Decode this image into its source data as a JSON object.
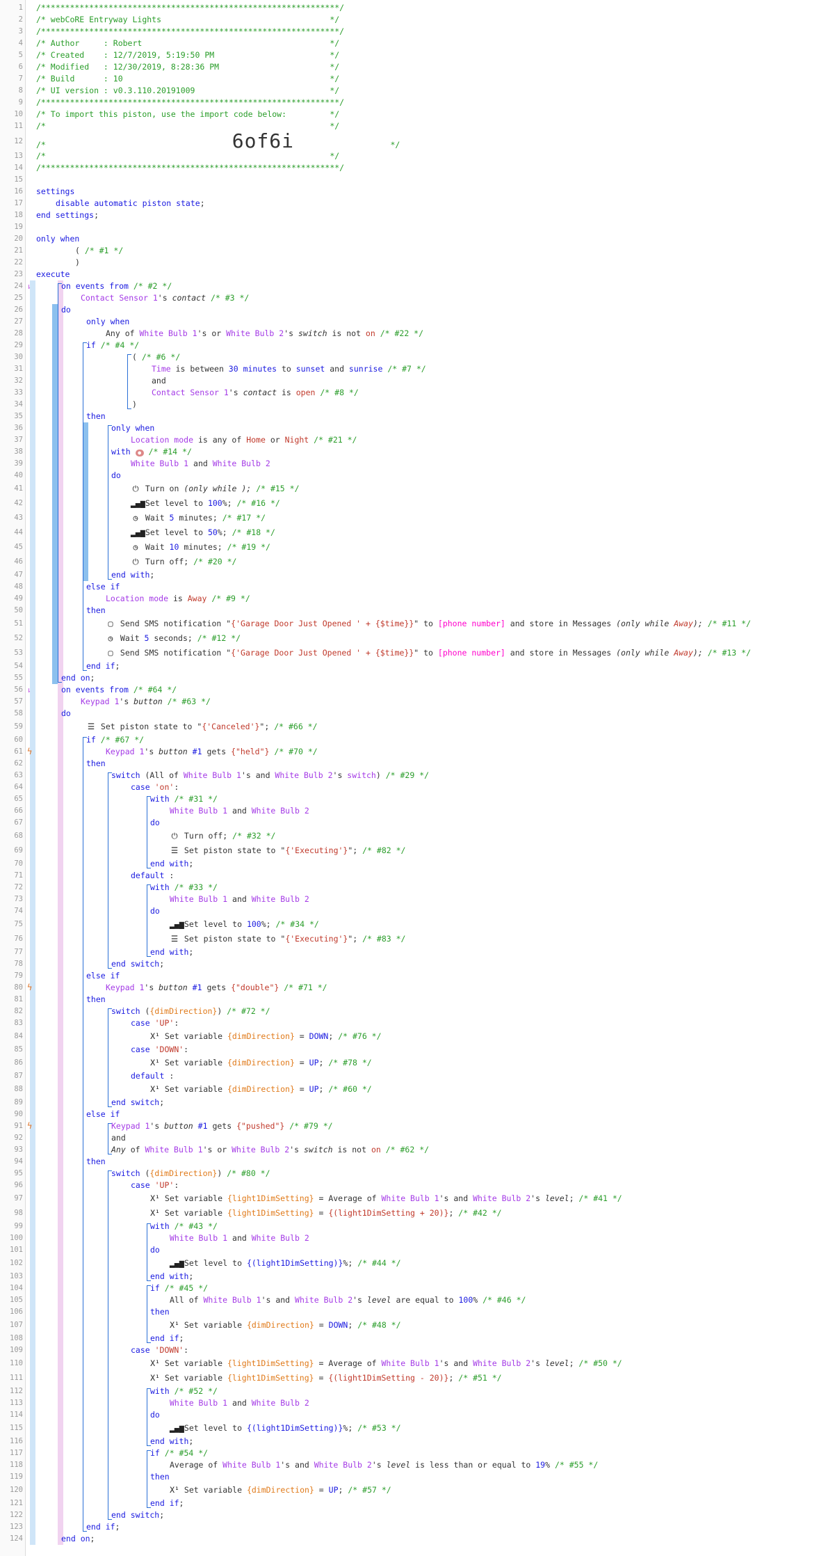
{
  "piston": {
    "name": "webCoRE Entryway Lights",
    "author": "Robert",
    "created": "12/7/2019, 5:19:50 PM",
    "modified": "12/30/2019, 8:28:36 PM",
    "build": "10",
    "ui_version": "v0.3.110.20191009",
    "import_code": "6of6i"
  },
  "icons": {
    "power": "power-icon",
    "level": "signal-bars-icon",
    "clock": "clock-icon",
    "sms": "message-icon",
    "state": "list-icon",
    "var": "variable-icon",
    "event": "lightning-icon"
  },
  "colors": {
    "comment": "#2a9d2a",
    "keyword": "#1a1ae0",
    "device": "#a43ae6",
    "string": "#c0392b",
    "variable": "#e07a1a",
    "placeholder": "#ff00cc",
    "selection_bar": "#8cc0ee"
  }
}
